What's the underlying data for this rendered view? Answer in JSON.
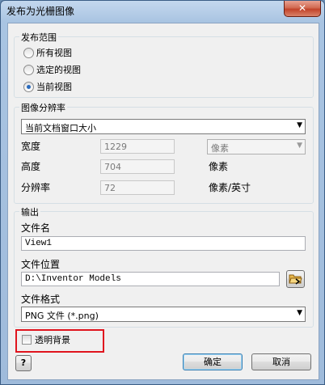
{
  "window": {
    "title": "发布为光栅图像",
    "close_glyph": "✕"
  },
  "scope": {
    "label": "发布范围",
    "options": [
      {
        "label": "所有视图",
        "selected": false
      },
      {
        "label": "选定的视图",
        "selected": false
      },
      {
        "label": "当前视图",
        "selected": true
      }
    ]
  },
  "resolution": {
    "label": "图像分辨率",
    "preset": "当前文档窗口大小",
    "width_label": "宽度",
    "width_value": "1229",
    "height_label": "高度",
    "height_value": "704",
    "dpi_label": "分辨率",
    "dpi_value": "72",
    "unit_select": "像素",
    "height_unit": "像素",
    "dpi_unit": "像素/英寸"
  },
  "output": {
    "label": "输出",
    "filename_label": "文件名",
    "filename_value": "View1",
    "location_label": "文件位置",
    "location_value": "D:\\Inventor Models",
    "format_label": "文件格式",
    "format_value": "PNG 文件 (*.png)"
  },
  "transparent_bg": {
    "label": "透明背景",
    "checked": false
  },
  "buttons": {
    "help": "?",
    "ok": "确定",
    "cancel": "取消"
  }
}
